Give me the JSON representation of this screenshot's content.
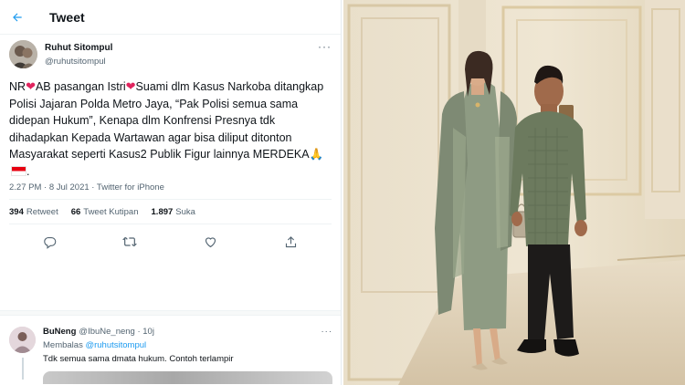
{
  "header": {
    "title": "Tweet"
  },
  "tweet": {
    "author_name": "Ruhut Sitompul",
    "author_handle": "@ruhutsitompul",
    "text_part1": "NR",
    "text_part2": "AB pasangan Istri",
    "text_part3": "Suami dlm Kasus Narkoba ditangkap Polisi Jajaran Polda Metro Jaya, “Pak Polisi semua sama didepan Hukum”, Kenapa   dlm Konfrensi Presnya tdk dihadapkan Kepada Wartawan agar bisa diliput ditonton Masyarakat seperti Kasus2 Publik Figur lainnya MERDEKA",
    "emoji_pray": "🙏",
    "timestamp": "2.27 PM · 8 Jul 2021 · Twitter for iPhone",
    "retweet_count": "394",
    "retweet_label": "Retweet",
    "quote_count": "66",
    "quote_label": "Tweet Kutipan",
    "like_count": "1.897",
    "like_label": "Suka"
  },
  "reply": {
    "name": "BuNeng",
    "handle_time": "@IbuNe_neng · 10j",
    "replying_prefix": "Membalas",
    "replying_to": "@ruhutsitompul",
    "text": "Tdk semua sama dmata hukum. Contoh terlampir"
  },
  "icons": [
    "back-arrow-icon",
    "more-icon",
    "heart-icon",
    "flag-icon",
    "reply-icon",
    "retweet-icon",
    "like-icon",
    "share-icon"
  ],
  "colors": {
    "accent": "#1d9bf0",
    "heart": "#e0245e",
    "secondary_text": "#536471"
  }
}
